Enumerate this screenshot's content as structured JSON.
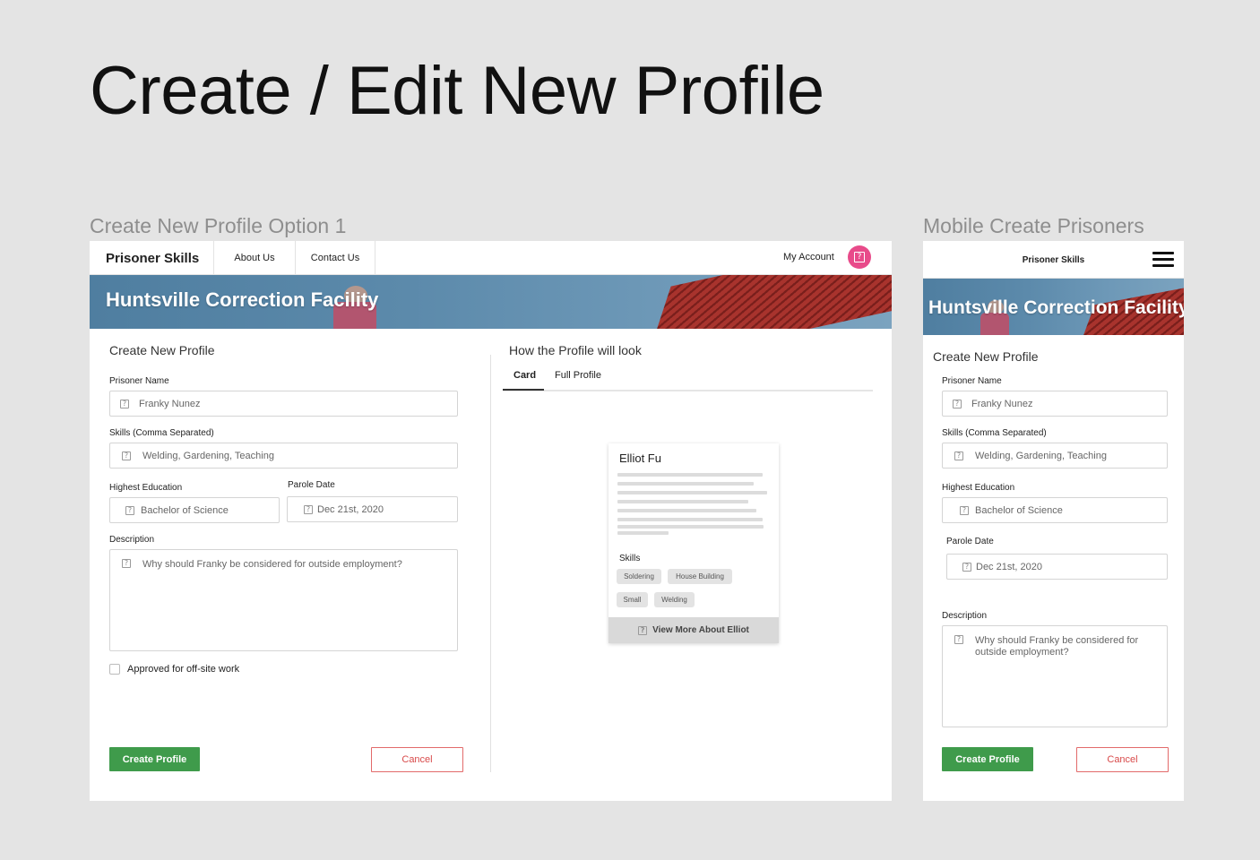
{
  "page_title": "Create / Edit New Profile",
  "desktop": {
    "artboard_label": "Create New Profile Option 1",
    "nav": {
      "brand": "Prisoner Skills",
      "about": "About Us",
      "contact": "Contact Us",
      "account": "My Account"
    },
    "hero_title": "Huntsville Correction Facility",
    "form": {
      "heading": "Create New Profile",
      "name_label": "Prisoner Name",
      "name_value": "Franky Nunez",
      "skills_label": "Skills (Comma Separated)",
      "skills_value": "Welding, Gardening, Teaching",
      "education_label": "Highest Education",
      "education_value": "Bachelor of Science",
      "parole_label": "Parole Date",
      "parole_value": "Dec 21st, 2020",
      "description_label": "Description",
      "description_placeholder": "Why should Franky be considered for outside employment?",
      "approved_label": "Approved for off-site work",
      "approved_checked": false,
      "create_button": "Create Profile",
      "cancel_button": "Cancel"
    },
    "preview": {
      "heading": "How the Profile will look",
      "tabs": [
        "Card",
        "Full Profile"
      ],
      "active_tab": "Card",
      "card": {
        "name": "Elliot Fu",
        "skills_title": "Skills",
        "skills": [
          "Soldering",
          "House Building",
          "Small",
          "Welding"
        ],
        "footer": "View More About Elliot"
      }
    }
  },
  "mobile": {
    "artboard_label": "Mobile Create Prisoners",
    "brand": "Prisoner Skills",
    "hero_title": "Huntsville Correction Facility",
    "form": {
      "heading": "Create New Profile",
      "name_label": "Prisoner Name",
      "name_value": "Franky Nunez",
      "skills_label": "Skills (Comma Separated)",
      "skills_value": "Welding, Gardening, Teaching",
      "education_label": "Highest Education",
      "education_value": "Bachelor of Science",
      "parole_label": "Parole Date",
      "parole_value": "Dec 21st, 2020",
      "description_label": "Description",
      "description_placeholder": "Why should Franky be considered for outside employment?",
      "create_button": "Create Profile",
      "cancel_button": "Cancel"
    }
  },
  "colors": {
    "accent_green": "#3f9b4b",
    "cancel_red": "#d84a4a",
    "avatar_pink": "#e84b8a"
  }
}
